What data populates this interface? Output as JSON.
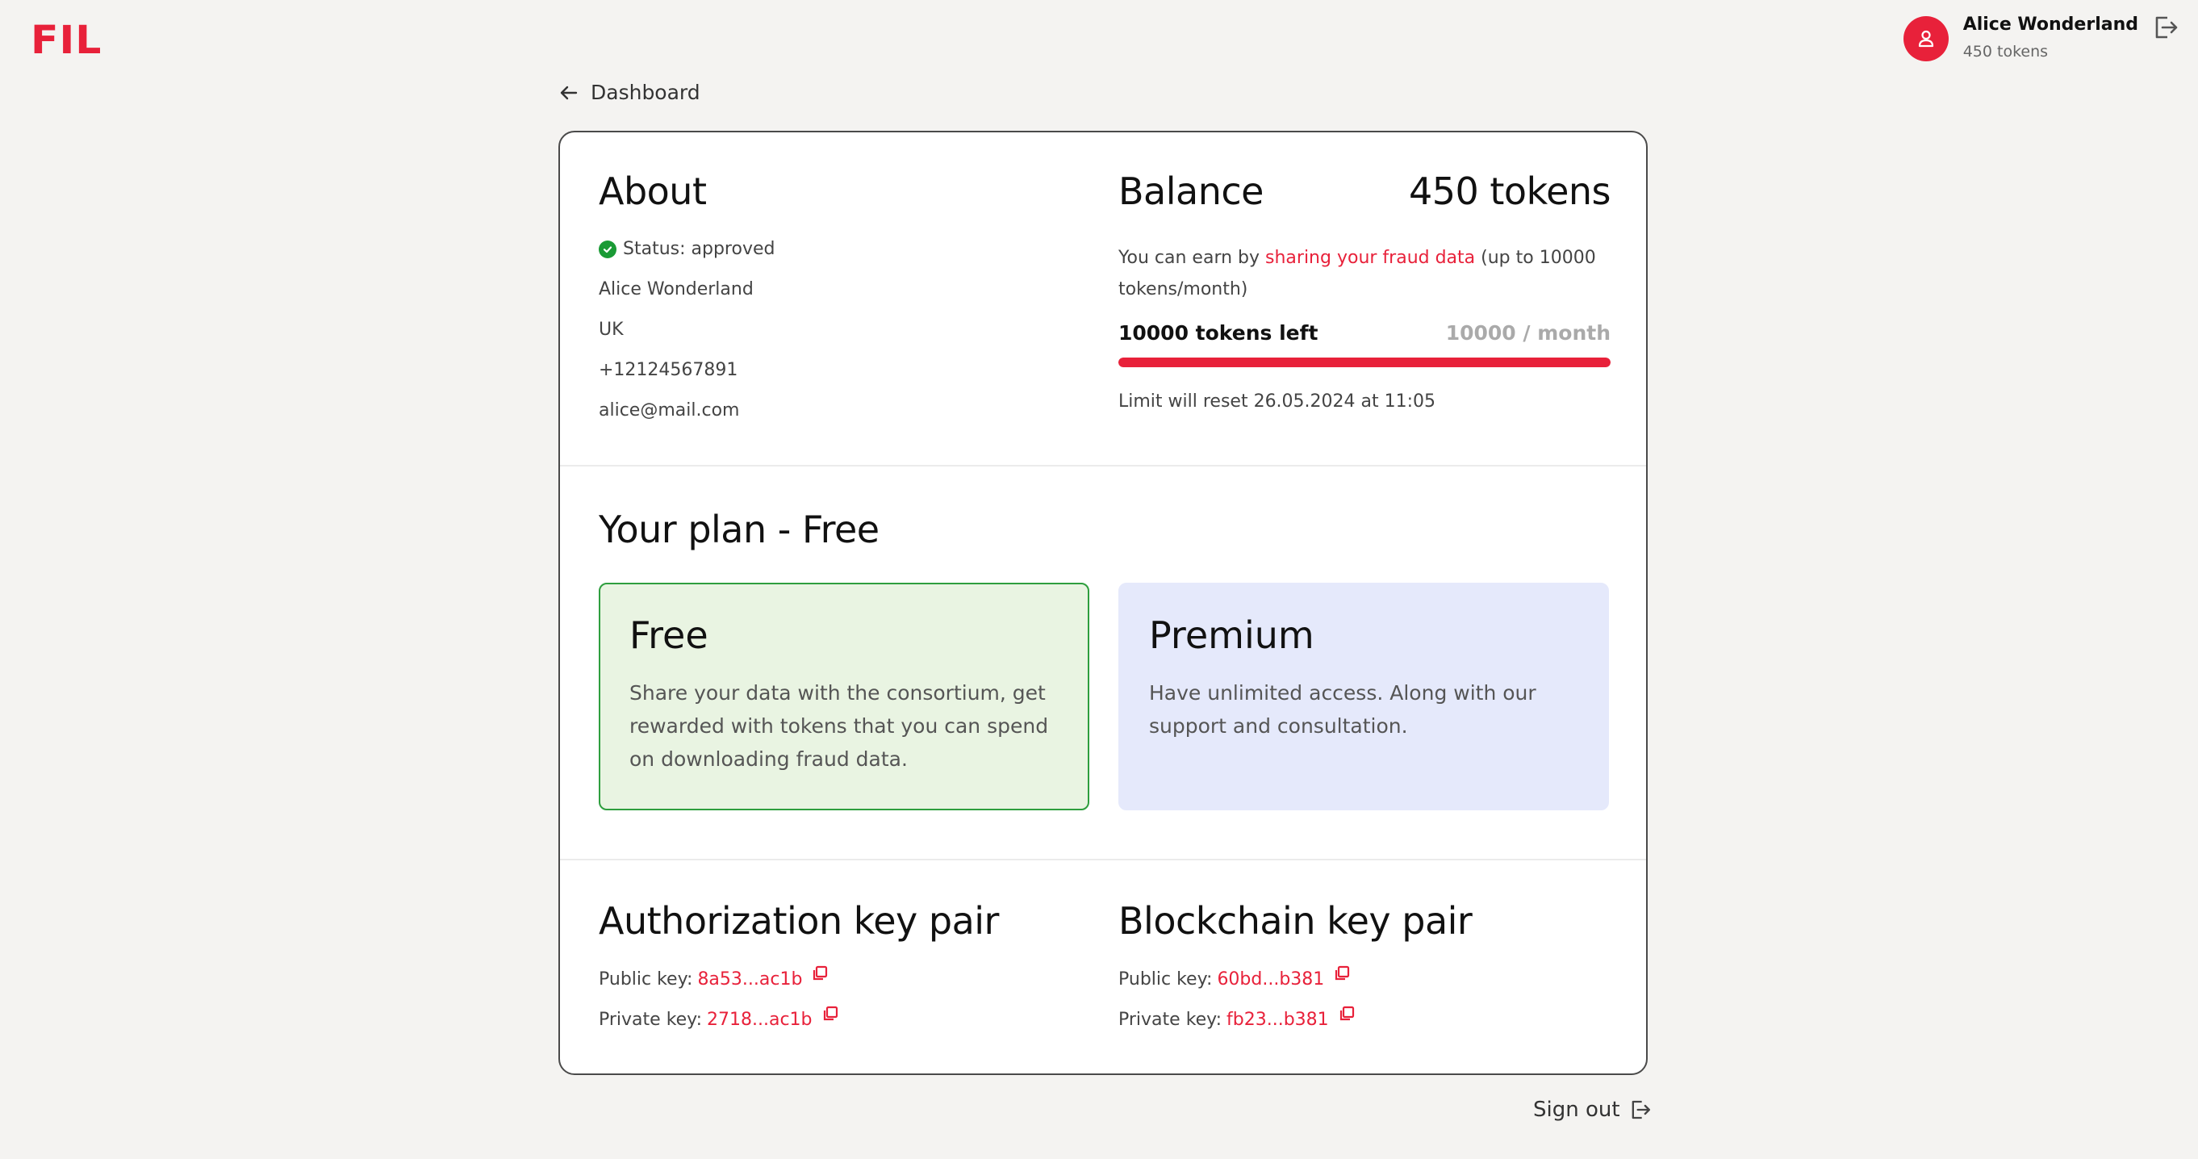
{
  "brand": {
    "logo": "FIL",
    "accent": "#e8213a"
  },
  "user": {
    "name": "Alice Wonderland",
    "tokens": "450 tokens"
  },
  "nav": {
    "back_label": "Dashboard"
  },
  "about": {
    "title": "About",
    "status": "Status: approved",
    "name": "Alice Wonderland",
    "country": "UK",
    "phone": "+12124567891",
    "email": "alice@mail.com"
  },
  "balance": {
    "title": "Balance",
    "amount": "450 tokens",
    "desc_prefix": "You can earn by ",
    "desc_link": "sharing your fraud data",
    "desc_suffix": " (up to 10000 tokens/month)",
    "tokens_left": "10000 tokens left",
    "limit": "10000 / month",
    "progress_fraction": 1.0,
    "reset": "Limit will reset 26.05.2024 at 11:05"
  },
  "plan": {
    "title": "Your plan - Free",
    "options": [
      {
        "name": "Free",
        "desc": "Share your data with the consortium, get rewarded with tokens that you can spend on downloading fraud data.",
        "selected": true
      },
      {
        "name": "Premium",
        "desc": "Have unlimited access. Along with our support and consultation.",
        "selected": false
      }
    ]
  },
  "auth_keys": {
    "title": "Authorization key pair",
    "public_label": "Public key:",
    "public_value": "8a53...ac1b",
    "private_label": "Private key:",
    "private_value": "2718...ac1b"
  },
  "chain_keys": {
    "title": "Blockchain key pair",
    "public_label": "Public key:",
    "public_value": "60bd...b381",
    "private_label": "Private key:",
    "private_value": "fb23...b381"
  },
  "footer": {
    "signout_label": "Sign out"
  },
  "icons": [
    "user-icon",
    "logout-icon",
    "arrow-left-icon",
    "check-circle-icon",
    "copy-icon"
  ]
}
